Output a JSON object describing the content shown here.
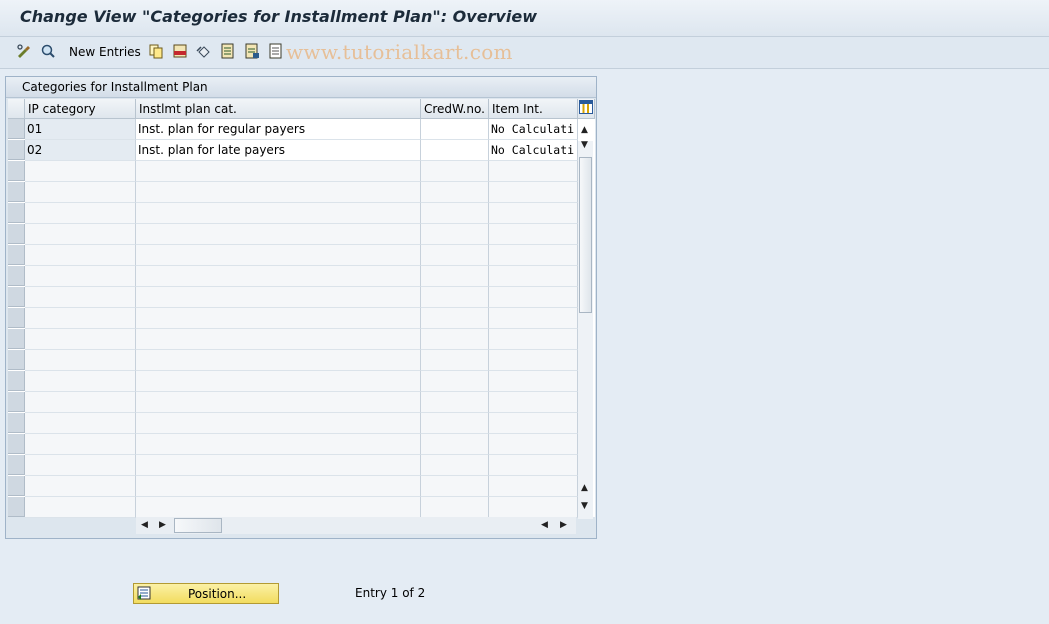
{
  "window": {
    "title": "Change View \"Categories for Installment Plan\": Overview"
  },
  "toolbar": {
    "new_entries_label": "New Entries",
    "icons": [
      "display-change-icon",
      "other-view-icon",
      "copy-icon",
      "delete-icon",
      "undo-icon",
      "select-all-icon",
      "select-block-icon",
      "deselect-all-icon"
    ]
  },
  "watermark": "www.tutorialkart.com",
  "table": {
    "title": "Categories for Installment Plan",
    "columns": [
      "IP category",
      "Instlmt plan cat.",
      "CredW.no.",
      "Item Int."
    ],
    "rows": [
      {
        "ip_category": "01",
        "plan_cat": "Inst. plan for regular payers",
        "credw_no": "",
        "item_int": "No Calculati"
      },
      {
        "ip_category": "02",
        "plan_cat": "Inst. plan for late payers",
        "credw_no": "",
        "item_int": "No Calculati"
      }
    ],
    "empty_rows": 17
  },
  "footer": {
    "position_button_label": "Position...",
    "entry_status": "Entry 1 of 2"
  }
}
